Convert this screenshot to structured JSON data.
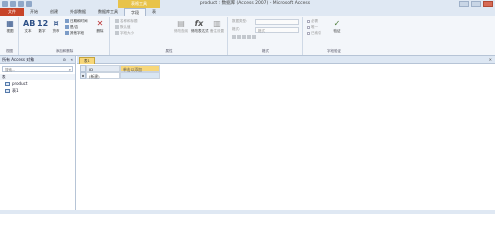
{
  "title_bar": {
    "context_tab": "表格工具",
    "title": "product : 数据库 (Access 2007) - Microsoft Access"
  },
  "ribbon_tabs": [
    "文件",
    "开始",
    "创建",
    "外部数据",
    "数据库工具",
    "字段",
    "表"
  ],
  "ribbon": {
    "views": {
      "btn": "视图",
      "group": "视图"
    },
    "add_delete": {
      "group": "添加和删除",
      "text": "文本",
      "number_icon": "12",
      "number": "数字",
      "currency": "货币",
      "datetime": "日期和时间",
      "yesno": "是/否",
      "more": "其他字段",
      "delete": "删除"
    },
    "properties": {
      "group": "属性",
      "name_caption": "名称和标题",
      "default_value": "默认值",
      "field_size": "字段大小",
      "modify_lookups": "修改查阅",
      "modify_expression": "修改表达式",
      "memo_settings": "备注设置"
    },
    "formatting": {
      "group": "格式",
      "data_type": "数据类型:",
      "format": "格式:",
      "format_value": "格式"
    },
    "validation": {
      "group": "字段验证",
      "required": "必需",
      "unique": "唯一",
      "indexed": "已索引",
      "validation_btn": "验证"
    }
  },
  "nav": {
    "header": "所有 Access 对象",
    "search_placeholder": "搜索...",
    "group": "表",
    "items": [
      "product",
      "表1"
    ]
  },
  "doc": {
    "tab": "表1",
    "columns": [
      "ID",
      "单击以添加"
    ],
    "new_row": "(新建)"
  }
}
